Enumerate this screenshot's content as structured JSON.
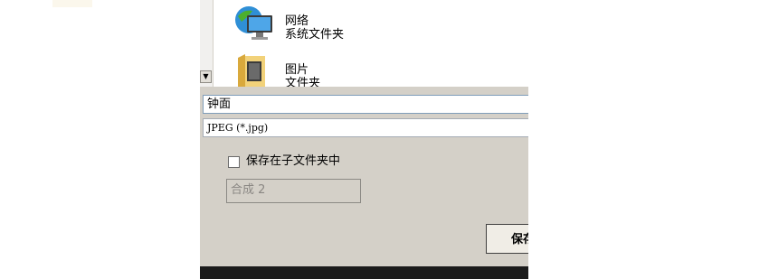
{
  "file_list": {
    "items": [
      {
        "name": "网络",
        "type": "系统文件夹",
        "icon": "network-folder-icon"
      },
      {
        "name": "图片",
        "type": "文件夹",
        "icon": "folder-icon"
      }
    ],
    "scroll_arrow": "▼"
  },
  "save_form": {
    "filename": "钟面",
    "filetype": "JPEG (*.jpg)",
    "checkbox_label": "保存在子文件夹中",
    "checkbox_checked": false,
    "subfolder_value": "合成 2",
    "save_button_label": "保存"
  },
  "colors": {
    "dialog_bg": "#d4d0c8",
    "field_border": "#7f9db9",
    "disabled_text": "#8a8783"
  }
}
